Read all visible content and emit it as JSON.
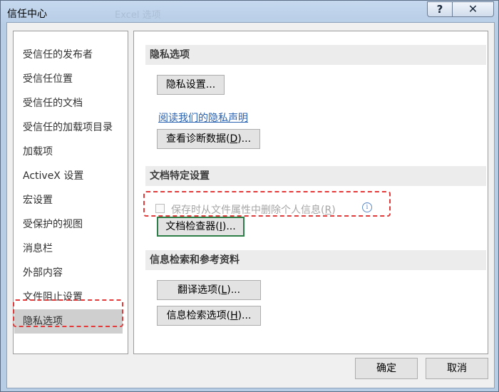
{
  "window": {
    "title": "信任中心",
    "ghost_title": "Excel 选项",
    "help_glyph": "?",
    "close_glyph": "✕"
  },
  "nav": {
    "items": [
      {
        "label": "受信任的发布者",
        "active": false
      },
      {
        "label": "受信任位置",
        "active": false
      },
      {
        "label": "受信任的文档",
        "active": false
      },
      {
        "label": "受信任的加载项目录",
        "active": false
      },
      {
        "label": "加载项",
        "active": false
      },
      {
        "label": "ActiveX 设置",
        "active": false
      },
      {
        "label": "宏设置",
        "active": false
      },
      {
        "label": "受保护的视图",
        "active": false
      },
      {
        "label": "消息栏",
        "active": false
      },
      {
        "label": "外部内容",
        "active": false
      },
      {
        "label": "文件阻止设置",
        "active": false
      },
      {
        "label": "隐私选项",
        "active": true
      }
    ]
  },
  "privacy": {
    "header": "隐私选项",
    "settings_button": "隐私设置...",
    "statement_link": "阅读我们的隐私声明",
    "diag_button": {
      "prefix": "查看诊断数据(",
      "key": "D",
      "suffix": ")..."
    }
  },
  "document_settings": {
    "header": "文档特定设置",
    "remove_info": {
      "prefix": "保存时从文件属性中删除个人信息(",
      "key": "R",
      "suffix": ")",
      "checked": false,
      "enabled": false
    },
    "info_glyph": "i",
    "inspector_button": {
      "prefix": "文档检查器(",
      "key": "I",
      "suffix": ")..."
    }
  },
  "research": {
    "header": "信息检索和参考资料",
    "translate_button": {
      "prefix": "翻译选项(",
      "key": "L",
      "suffix": ")..."
    },
    "research_button": {
      "prefix": "信息检索选项(",
      "key": "H",
      "suffix": ")..."
    }
  },
  "footer": {
    "ok": "确定",
    "cancel": "取消"
  }
}
